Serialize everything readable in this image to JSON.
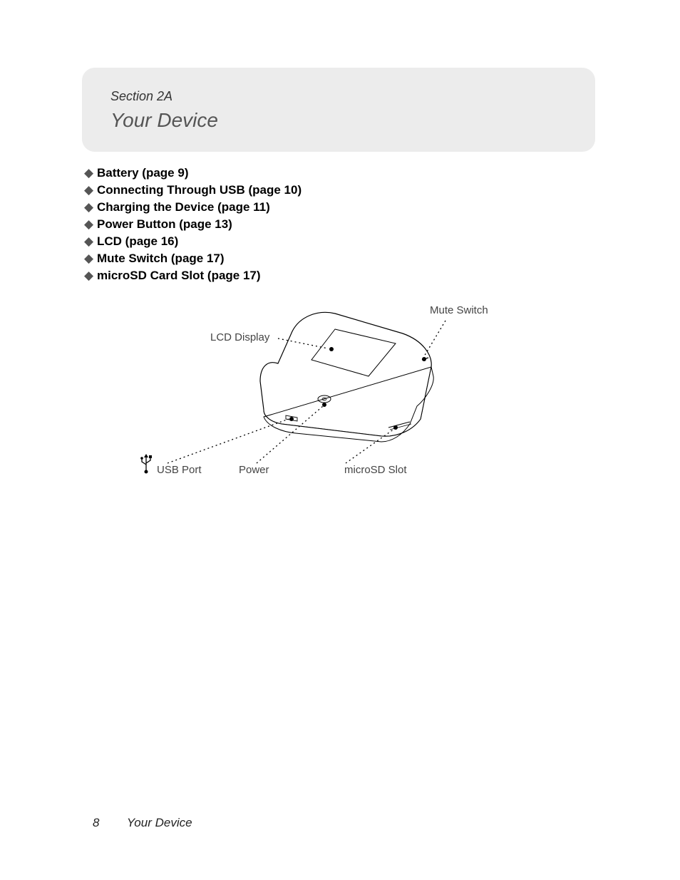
{
  "header": {
    "section_label": "Section 2A",
    "title": "Your Device"
  },
  "toc": [
    "Battery (page 9)",
    "Connecting Through USB (page 10)",
    "Charging the Device (page 11)",
    "Power Button (page 13)",
    "LCD (page 16)",
    "Mute Switch (page 17)",
    "microSD Card Slot (page 17)"
  ],
  "diagram": {
    "labels": {
      "mute_switch": "Mute Switch",
      "lcd_display": "LCD Display",
      "usb_port": "USB Port",
      "power": "Power",
      "microsd_slot": "microSD Slot"
    }
  },
  "footer": {
    "page_number": "8",
    "title": "Your Device"
  }
}
